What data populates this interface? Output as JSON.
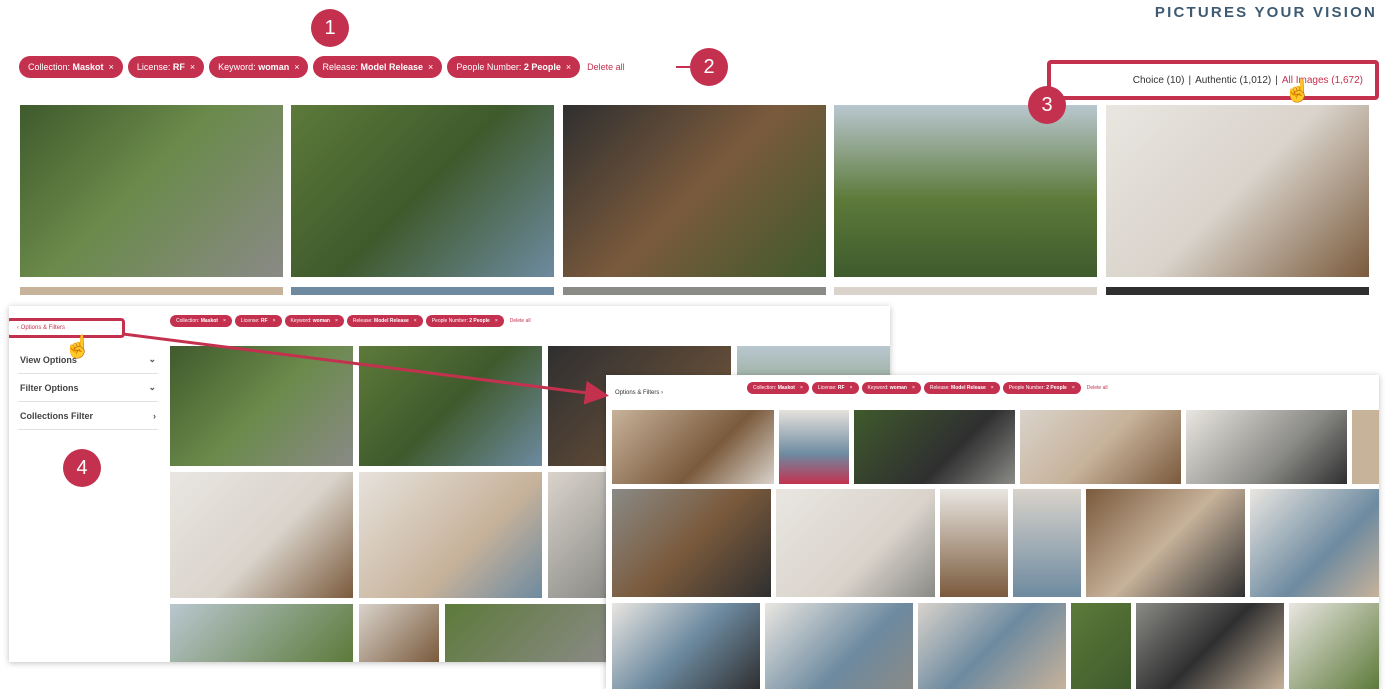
{
  "brand": "PICTURES YOUR VISION",
  "filter_chips": [
    {
      "label": "Collection:",
      "value": "Maskot"
    },
    {
      "label": "License:",
      "value": "RF"
    },
    {
      "label": "Keyword:",
      "value": "woman"
    },
    {
      "label": "Release:",
      "value": "Model Release"
    },
    {
      "label": "People Number:",
      "value": "2 People"
    }
  ],
  "remove_icon": "×",
  "delete_all": "Delete all",
  "badges": [
    "1",
    "2",
    "3",
    "4"
  ],
  "sort": {
    "choice": "Choice (10)",
    "separator": "|",
    "authentic": "Authentic (1,012)",
    "all_images": "All Images (1,672)"
  },
  "options_filters_collapsed": "‹ Options & Filters",
  "options_filters_expanded": "Options & Filters ›",
  "side_menu": [
    {
      "label": "View Options",
      "chevron": "⌄"
    },
    {
      "label": "Filter Options",
      "chevron": "⌄"
    },
    {
      "label": "Collections Filter",
      "chevron": "›"
    }
  ],
  "cursor_icon": "☝",
  "colors": {
    "accent": "#c4314f",
    "brand": "#3d5a72"
  },
  "photo_tones": {
    "green": "#5d7a3a",
    "forest": "#3f5a2c",
    "warm": "#7a5a3c",
    "light": "#d9d3cb",
    "grey": "#8a8a86",
    "blue": "#6d8aa0",
    "dark": "#2f2f30",
    "sand": "#c7b29a"
  }
}
